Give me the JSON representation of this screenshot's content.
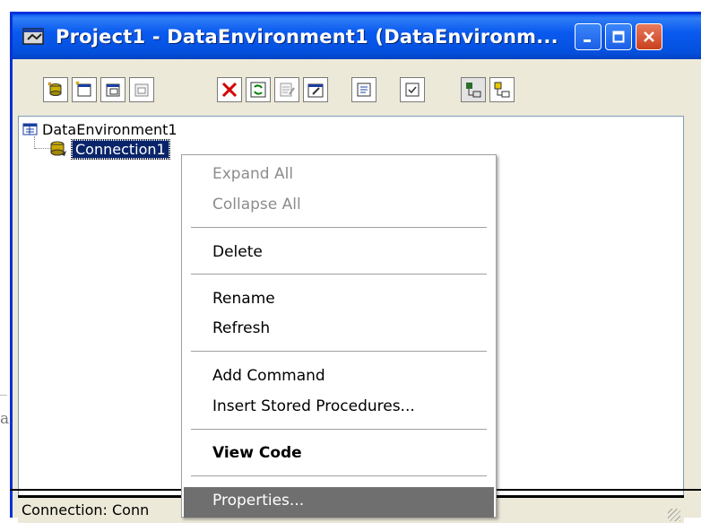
{
  "window": {
    "title": "Project1 - DataEnvironment1 (DataEnvironm..."
  },
  "toolbar": {
    "buttons": [
      {
        "name": "add-connection-icon"
      },
      {
        "name": "add-command-icon"
      },
      {
        "name": "add-child-command-icon"
      },
      {
        "name": "insert-stored-procedures-icon"
      },
      {
        "name": "delete-icon"
      },
      {
        "name": "refresh-icon"
      },
      {
        "name": "design-icon"
      },
      {
        "name": "properties-icon"
      },
      {
        "name": "view-code-icon"
      },
      {
        "name": "options-icon"
      },
      {
        "name": "arrange-by-objects-icon"
      },
      {
        "name": "arrange-by-connections-icon"
      }
    ]
  },
  "tree": {
    "root_label": "DataEnvironment1",
    "child_label": "Connection1"
  },
  "context_menu": {
    "expand_all": "Expand All",
    "collapse_all": "Collapse All",
    "delete": "Delete",
    "rename": "Rename",
    "refresh": "Refresh",
    "add_command": "Add Command",
    "insert_stored_procedures": "Insert Stored Procedures...",
    "view_code": "View Code",
    "properties": "Properties..."
  },
  "statusbar": {
    "text": "Connection:  Conn"
  },
  "background": {
    "glyph": "a"
  },
  "colors": {
    "titlebar": "#0a5af0",
    "selection": "#0a246a",
    "menu_highlight": "#6f6f6f",
    "close_button": "#c8401e"
  }
}
